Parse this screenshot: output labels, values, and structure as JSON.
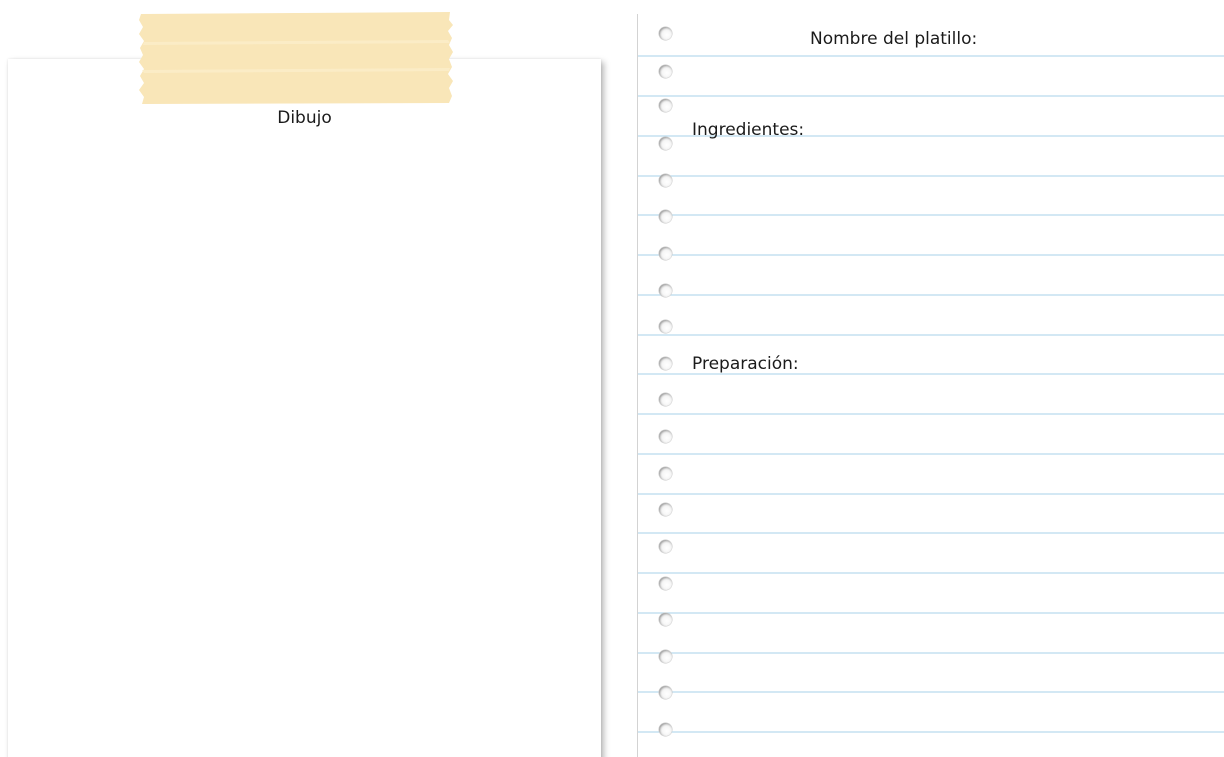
{
  "drawing_card": {
    "label": "Dibujo"
  },
  "notebook": {
    "title": "Nombre del platillo:",
    "sections": {
      "ingredients": "Ingredientes:",
      "preparation": "Preparación:"
    }
  },
  "colors": {
    "tape": "#f9e6b8",
    "rule_line": "#b9dbee",
    "margin_line": "#d3d3d3",
    "text": "#1b1b1b"
  }
}
